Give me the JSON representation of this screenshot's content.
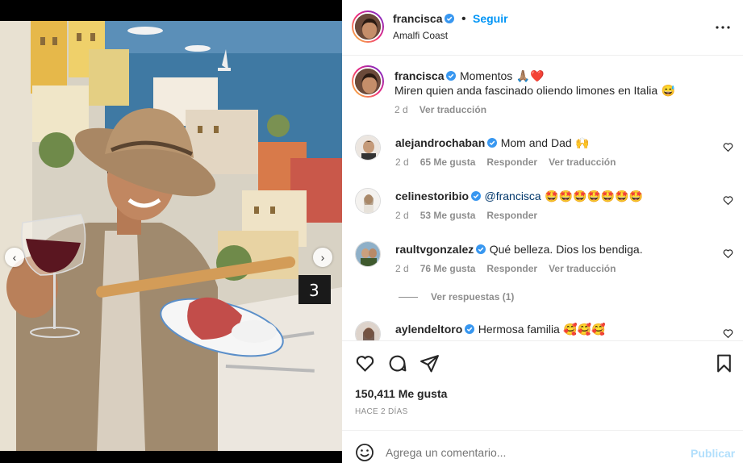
{
  "post": {
    "author": "francisca",
    "follow_label": "Seguir",
    "location": "Amalfi Coast",
    "caption_first": "Momentos",
    "caption_emojis": "🙏🏽❤️",
    "caption_second": "Miren quien anda fascinado oliendo limones en Italia",
    "caption_emoji_end": "😅",
    "caption_age": "2 d",
    "translate_label": "Ver traducción",
    "likes": "150,411 Me gusta",
    "date": "HACE 2 DÍAS",
    "table_number": "3"
  },
  "comments": [
    {
      "user": "alejandrochaban",
      "text": "Mom and Dad",
      "emoji": "🙌",
      "age": "2 d",
      "likes": "65 Me gusta",
      "reply": "Responder",
      "translate": "Ver traducción"
    },
    {
      "user": "celinestoribio",
      "mention": "@francisca",
      "emoji": "🤩🤩🤩🤩🤩🤩🤩",
      "age": "2 d",
      "likes": "53 Me gusta",
      "reply": "Responder"
    },
    {
      "user": "raultvgonzalez",
      "text": "Qué belleza. Dios los bendiga.",
      "age": "2 d",
      "likes": "76 Me gusta",
      "reply": "Responder",
      "translate": "Ver traducción",
      "view_replies": "Ver respuestas (1)"
    },
    {
      "user": "aylendeltoro",
      "text": "Hermosa familia",
      "emoji": "🥰🥰🥰"
    }
  ],
  "composer": {
    "placeholder": "Agrega un comentario...",
    "publish_label": "Publicar"
  },
  "colors": {
    "accent": "#0095f6",
    "verified": "#3897f0",
    "muted": "#8e8e8e",
    "publish_disabled": "#b2dffc"
  },
  "carousel": {
    "count": 8,
    "active": 5
  }
}
